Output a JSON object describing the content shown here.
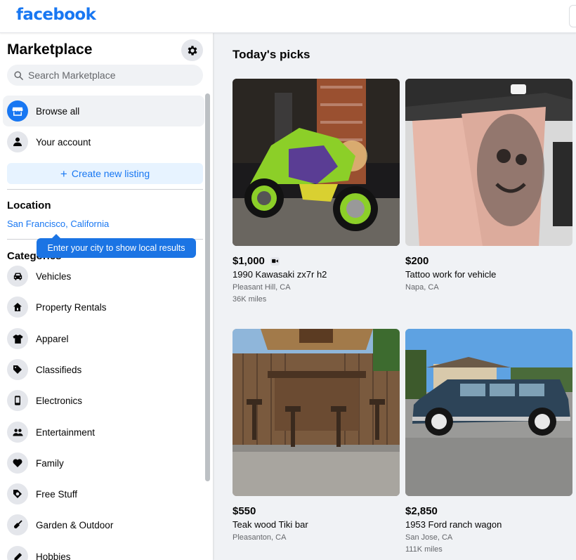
{
  "header": {
    "logo": "facebook"
  },
  "sidebar": {
    "title": "Marketplace",
    "search_placeholder": "Search Marketplace",
    "browse_all": "Browse all",
    "your_account": "Your account",
    "create_listing": "Create new listing",
    "location_heading": "Location",
    "location_value": "San Francisco, California",
    "tooltip": "Enter your city to show local results",
    "categories_heading": "Categories",
    "categories": [
      {
        "label": "Vehicles",
        "icon": "car-icon"
      },
      {
        "label": "Property Rentals",
        "icon": "house-icon"
      },
      {
        "label": "Apparel",
        "icon": "shirt-icon"
      },
      {
        "label": "Classifieds",
        "icon": "tag-icon"
      },
      {
        "label": "Electronics",
        "icon": "phone-icon"
      },
      {
        "label": "Entertainment",
        "icon": "people-icon"
      },
      {
        "label": "Family",
        "icon": "heart-icon"
      },
      {
        "label": "Free Stuff",
        "icon": "free-tag-icon"
      },
      {
        "label": "Garden & Outdoor",
        "icon": "shovel-icon"
      },
      {
        "label": "Hobbies",
        "icon": "pencil-icon"
      }
    ]
  },
  "main": {
    "title": "Today's picks",
    "listings": [
      {
        "price": "$1,000",
        "title": "1990 Kawasaki zx7r h2",
        "location": "Pleasant Hill, CA",
        "miles": "36K miles",
        "has_video": true
      },
      {
        "price": "$200",
        "title": "Tattoo work for vehicle",
        "location": "Napa, CA",
        "miles": ""
      },
      {
        "price": "$550",
        "title": "Teak wood Tiki bar",
        "location": "Pleasanton, CA",
        "miles": ""
      },
      {
        "price": "$2,850",
        "title": "1953 Ford ranch wagon",
        "location": "San Jose, CA",
        "miles": "111K miles"
      }
    ]
  },
  "colors": {
    "accent": "#1877f2",
    "background": "#f0f2f5",
    "secondary_text": "#65676b"
  }
}
